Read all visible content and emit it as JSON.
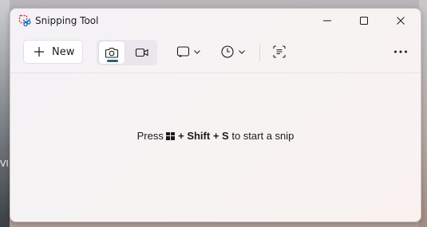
{
  "window": {
    "title": "Snipping Tool",
    "desktop_partial_label": "VI"
  },
  "toolbar": {
    "new_label": "New",
    "modes": {
      "photo": "camera-icon",
      "video": "video-camera-icon",
      "selected": "photo"
    },
    "snip_shape_icon": "rectangle-snip-icon",
    "delay_icon": "clock-icon",
    "text_actions_icon": "text-actions-icon",
    "more_icon": "more-options-icon"
  },
  "hint": {
    "prefix": "Press",
    "plus1": "+",
    "shift": "Shift",
    "plus2": "+",
    "key": "S",
    "suffix": "to start a snip"
  },
  "colors": {
    "accent": "#236671",
    "window_bg": "#f6f3f4"
  }
}
